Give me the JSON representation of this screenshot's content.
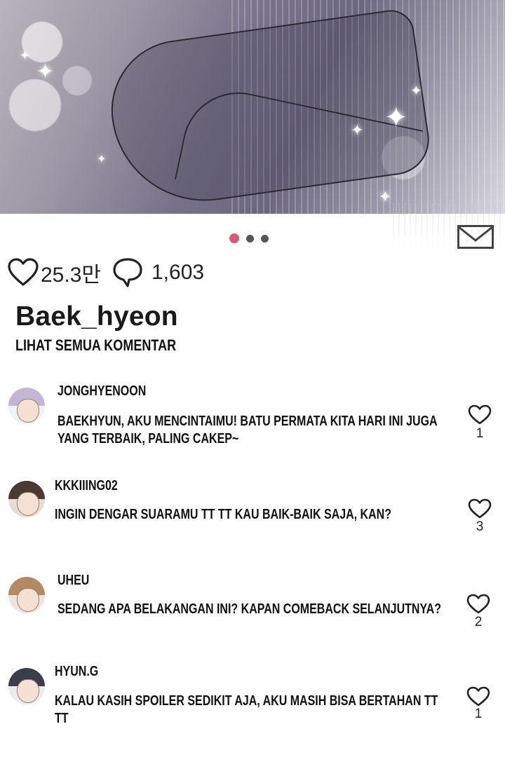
{
  "post": {
    "likes": "25.3만",
    "comments_count": "1,603",
    "username": "Baek_hyeon",
    "view_all_label": "LIHAT SEMUA KOMENTAR"
  },
  "pager": {
    "total": 3,
    "active_index": 0,
    "active_color": "#d65a76"
  },
  "comments": [
    {
      "user": "JONGHYENOON",
      "text": "BAEKHYUN, AKU MENCINTAIMU! BATU PERMATA KITA HARI INI JUGA YANG TERBAIK, PALING CAKEP~",
      "likes": "1"
    },
    {
      "user": "KKKIIING02",
      "text": "INGIN DENGAR SUARAMU TT TT KAU BAIK-BAIK SAJA, KAN?",
      "likes": "3"
    },
    {
      "user": "UHEU",
      "text": "SEDANG APA BELAKANGAN INI? KAPAN COMEBACK SELANJUTNYA?",
      "likes": "2"
    },
    {
      "user": "HYUN.G",
      "text": "KALAU KASIH SPOILER SEDIKIT AJA, AKU MASIH BISA BERTAHAN TT TT",
      "likes": "1"
    }
  ]
}
